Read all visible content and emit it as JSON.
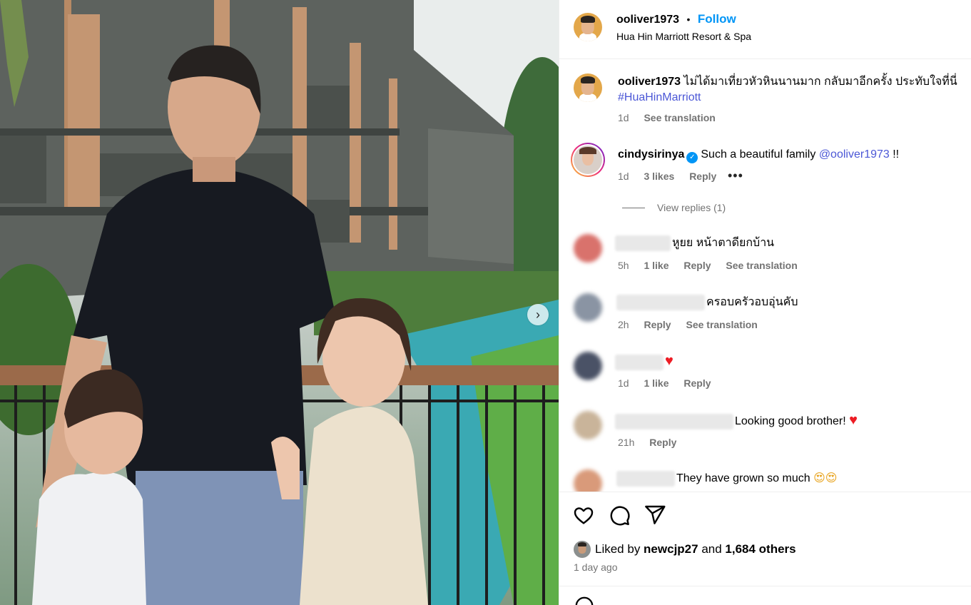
{
  "post": {
    "username": "ooliver1973",
    "separator": "•",
    "follow_label": "Follow",
    "location": "Hua Hin Marriott Resort & Spa",
    "next_icon": "chevron-right-icon"
  },
  "caption": {
    "username": "ooliver1973",
    "text": "ไม่ได้มาเที่ยวหัวหินนานมาก กลับมาอีกครั้ง ประทับใจที่นี่",
    "hashtag": "#HuaHinMarriott",
    "time": "1d",
    "translate": "See translation"
  },
  "comments": [
    {
      "username": "cindysirinya",
      "verified": true,
      "text": "Such a beautiful family",
      "mention": "@ooliver1973",
      "suffix": " !!",
      "time": "1d",
      "likes": "3 likes",
      "reply": "Reply",
      "more": "•••",
      "view_replies": "View replies (1)"
    },
    {
      "text": "หูยย หน้าตาดียกบ้าน",
      "time": "5h",
      "likes": "1 like",
      "reply": "Reply",
      "translate": "See translation",
      "avatar_color": "#d9726c"
    },
    {
      "text": "ครอบครัวอบอุ่นคับ",
      "time": "2h",
      "reply": "Reply",
      "translate": "See translation",
      "avatar_color": "#8a94a3"
    },
    {
      "text": "♥",
      "time": "1d",
      "likes": "1 like",
      "reply": "Reply",
      "avatar_color": "#4a5266"
    },
    {
      "text": "Looking good brother! ",
      "emoji": "♥",
      "time": "21h",
      "reply": "Reply",
      "avatar_color": "#c9b49a"
    },
    {
      "text": "They have grown so much ",
      "emoji": "😍😍",
      "avatar_color": "#d99a7a"
    }
  ],
  "footer": {
    "liked_by_prefix": "Liked by ",
    "liked_by_user": "newcjp27",
    "and": " and ",
    "others": "1,684 others",
    "ago": "1 day ago",
    "icons": [
      "heart-icon",
      "comment-icon",
      "share-icon"
    ]
  },
  "colors": {
    "follow": "#0095f6",
    "link": "#4b57d6",
    "secondary_text": "#737373",
    "heart": "#ed1c24"
  }
}
